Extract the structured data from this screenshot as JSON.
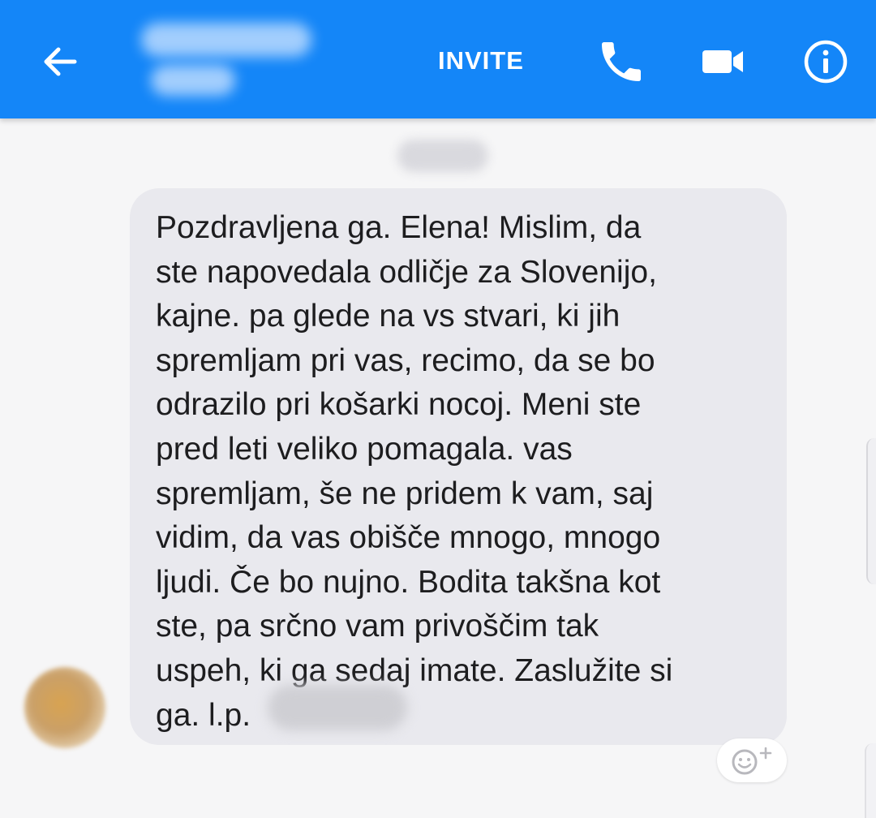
{
  "header": {
    "back_icon": "arrow-left-icon",
    "contact_name": "",
    "invite_label": "INVITE",
    "call_icon": "phone-icon",
    "video_icon": "video-camera-icon",
    "info_icon": "info-icon",
    "background_color": "#1486f8"
  },
  "conversation": {
    "timestamp": "",
    "message": {
      "lines": [
        "Pozdravljena ga. Elena! Mislim, da",
        "ste napovedala odličje za Slovenijo,",
        "kajne. pa glede na vs stvari, ki jih",
        "spremljam pri vas, recimo, da se bo",
        "odrazilo pri košarki nocoj. Meni ste",
        "pred leti veliko pomagala. vas",
        "spremljam, še ne pridem k vam, saj",
        "vidim, da vas obišče mnogo, mnogo",
        "ljudi. Če bo nujno. Bodita takšna kot",
        "ste, pa srčno vam privoščim tak",
        "uspeh, ki ga sedaj imate. Zaslužite si",
        "ga. l.p."
      ],
      "bubble_color": "#e9e9ee"
    },
    "react_icon": "add-reaction-icon",
    "avatar_icon": "avatar"
  }
}
